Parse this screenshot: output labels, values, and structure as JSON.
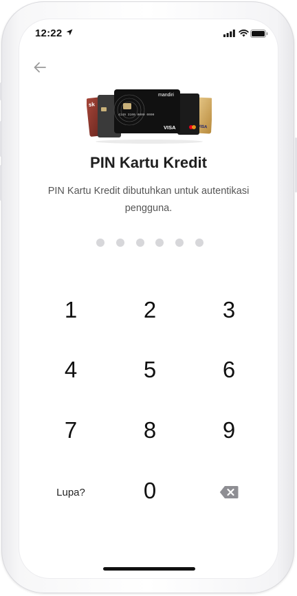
{
  "status_bar": {
    "time": "12:22",
    "icons": [
      "location-arrow-icon",
      "signal-icon",
      "wifi-icon",
      "battery-icon"
    ]
  },
  "header": {
    "back_icon": "arrow-left-icon"
  },
  "hero": {
    "card_brand_text": "mandiri",
    "card_network_text": "VISA",
    "card_number_text": "4149 3100 0000 0000"
  },
  "title": "PIN Kartu Kredit",
  "subtitle": "PIN Kartu Kredit dibutuhkan untuk autentikasi pengguna.",
  "pin": {
    "length": 6,
    "filled": 0
  },
  "keypad": {
    "keys": [
      "1",
      "2",
      "3",
      "4",
      "5",
      "6",
      "7",
      "8",
      "9"
    ],
    "zero": "0",
    "forgot_label": "Lupa?",
    "delete_icon": "backspace-icon"
  },
  "colors": {
    "dot": "#d7d7da",
    "text_primary": "#1f1f1f",
    "text_secondary": "#555555",
    "back_arrow": "#9a9a9a"
  }
}
